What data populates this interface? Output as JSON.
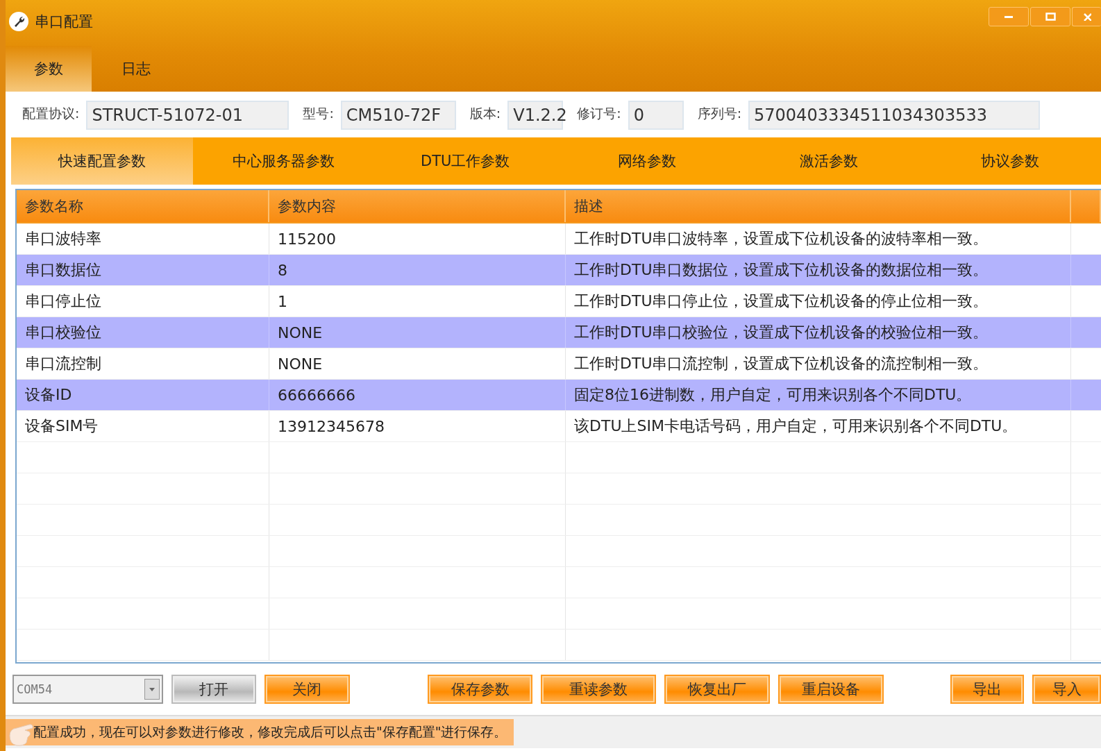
{
  "window": {
    "title": "串口配置"
  },
  "main_tabs": [
    {
      "label": "参数",
      "selected": true
    },
    {
      "label": "日志",
      "selected": false
    }
  ],
  "info_fields": [
    {
      "label": "配置协议:",
      "value": "STRUCT-51072-01",
      "kind": "wide"
    },
    {
      "label": "型号:",
      "value": "CM510-72F",
      "kind": "medium"
    },
    {
      "label": "版本:",
      "value": "V1.2.2",
      "kind": "small"
    },
    {
      "label": "修订号:",
      "value": "0",
      "kind": "small"
    },
    {
      "label": "序列号:",
      "value": "5700403334511034303533",
      "kind": "long"
    }
  ],
  "param_tabs": [
    {
      "label": "快速配置参数",
      "selected": true
    },
    {
      "label": "中心服务器参数",
      "selected": false
    },
    {
      "label": "DTU工作参数",
      "selected": false
    },
    {
      "label": "网络参数",
      "selected": false
    },
    {
      "label": "激活参数",
      "selected": false
    },
    {
      "label": "协议参数",
      "selected": false
    }
  ],
  "table": {
    "columns": [
      "参数名称",
      "参数内容",
      "描述"
    ],
    "rows": [
      [
        "串口波特率",
        "115200",
        "工作时DTU串口波特率，设置成下位机设备的波特率相一致。"
      ],
      [
        "串口数据位",
        "8",
        "工作时DTU串口数据位，设置成下位机设备的数据位相一致。"
      ],
      [
        "串口停止位",
        "1",
        "工作时DTU串口停止位，设置成下位机设备的停止位相一致。"
      ],
      [
        "串口校验位",
        "NONE",
        "工作时DTU串口校验位，设置成下位机设备的校验位相一致。"
      ],
      [
        "串口流控制",
        "NONE",
        "工作时DTU串口流控制，设置成下位机设备的流控制相一致。"
      ],
      [
        "设备ID",
        "66666666",
        "固定8位16进制数，用户自定，可用来识别各个不同DTU。"
      ],
      [
        "设备SIM号",
        "13912345678",
        "该DTU上SIM卡电话号码，用户自定，可用来识别各个不同DTU。"
      ]
    ]
  },
  "port_select": {
    "value": "COM54"
  },
  "buttons": [
    {
      "label": "打开",
      "disabled": true
    },
    {
      "label": "关闭",
      "disabled": false
    },
    {
      "label": "保存参数",
      "disabled": false
    },
    {
      "label": "重读参数",
      "disabled": false
    },
    {
      "label": "恢复出厂",
      "disabled": false
    },
    {
      "label": "重启设备",
      "disabled": false
    },
    {
      "label": "导出",
      "disabled": false
    },
    {
      "label": "导入",
      "disabled": false
    }
  ],
  "status_bar": {
    "message": "配置成功，现在可以对参数进行修改，修改完成后可以点击\"保存配置\"进行保存。"
  }
}
